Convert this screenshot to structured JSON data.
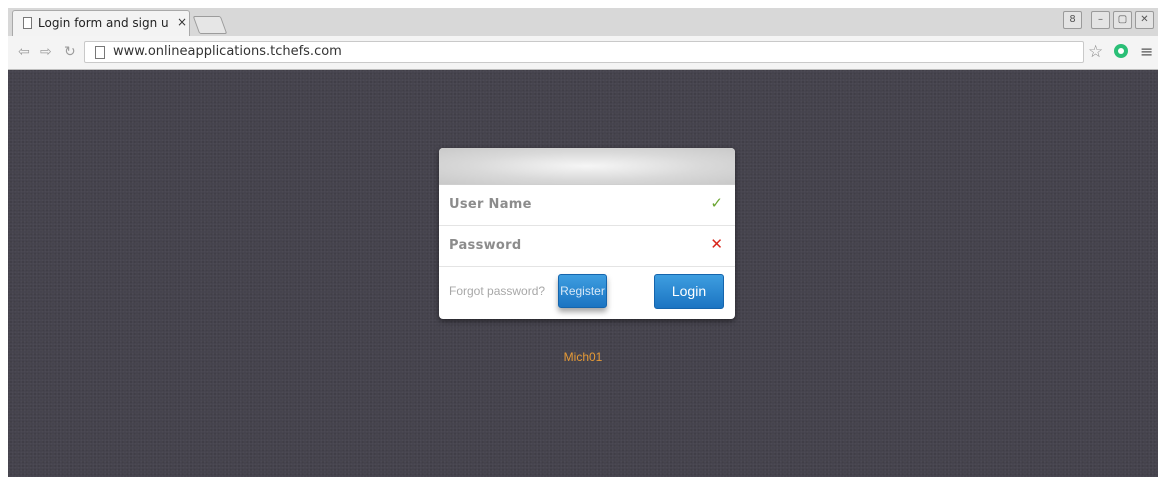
{
  "browser": {
    "tab_title": "Login form and sign u",
    "tab_close": "×",
    "url": "www.onlineapplications.tchefs.com",
    "window_buttons": [
      "8",
      "–",
      "▢",
      "✕"
    ]
  },
  "login_card": {
    "username_label": "User Name",
    "username_status": "✓",
    "password_label": "Password",
    "password_status": "✕",
    "forgot_link": "Forgot password?",
    "register_button": "Register",
    "login_button": "Login"
  },
  "footer": {
    "name": "Mich01"
  },
  "colors": {
    "page_background": "#45434d",
    "button_blue": "#1f7fcf",
    "check_green": "#6aa531",
    "cross_red": "#d9271c",
    "footer_orange": "#e69a36"
  },
  "icons": [
    "page-icon",
    "back-icon",
    "forward-icon",
    "reload-icon",
    "star-icon",
    "extension-icon",
    "menu-icon",
    "checkmark-icon",
    "cross-icon"
  ]
}
